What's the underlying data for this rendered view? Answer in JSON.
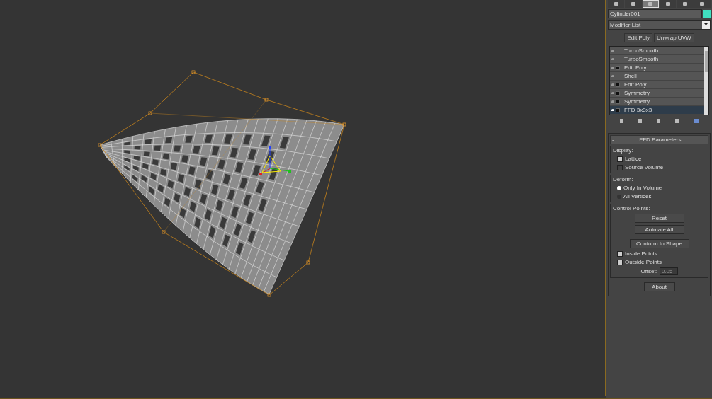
{
  "command_panel": {
    "tabs": [
      {
        "selected": false
      },
      {
        "selected": false
      },
      {
        "selected": true
      },
      {
        "selected": false
      },
      {
        "selected": false
      },
      {
        "selected": false
      }
    ]
  },
  "object": {
    "name": "Cylinder001",
    "color": "#40e0c0"
  },
  "modifier_list": {
    "label": "Modifier List"
  },
  "quick_buttons": [
    "Edit Poly",
    "Unwrap UVW"
  ],
  "stack": [
    {
      "name": "TurboSmooth",
      "kind": "plain",
      "selected": false
    },
    {
      "name": "TurboSmooth",
      "kind": "plain",
      "selected": false
    },
    {
      "name": "Edit Poly",
      "kind": "expandable",
      "selected": false
    },
    {
      "name": "Shell",
      "kind": "plain",
      "selected": false
    },
    {
      "name": "Edit Poly",
      "kind": "expandable",
      "selected": false
    },
    {
      "name": "Symmetry",
      "kind": "expandable",
      "selected": false
    },
    {
      "name": "Symmetry",
      "kind": "expandable",
      "selected": false
    },
    {
      "name": "FFD 3x3x3",
      "kind": "expandable",
      "selected": true
    }
  ],
  "rollout": {
    "sign": "-",
    "title": "FFD Parameters",
    "display": {
      "label": "Display:",
      "options": [
        {
          "label": "Lattice",
          "checked": true
        },
        {
          "label": "Source Volume",
          "checked": false
        }
      ]
    },
    "deform": {
      "label": "Deform:",
      "options": [
        {
          "label": "Only In Volume",
          "selected": true
        },
        {
          "label": "All Vertices",
          "selected": false
        }
      ]
    },
    "control_points": {
      "label": "Control Points:",
      "buttons": [
        "Reset",
        "Animate All",
        "Conform to Shape"
      ],
      "options": [
        {
          "label": "Inside Points",
          "checked": true
        },
        {
          "label": "Outside Points",
          "checked": true
        }
      ],
      "offset_label": "Offset:",
      "offset_value": "0.05"
    },
    "about": "About"
  }
}
